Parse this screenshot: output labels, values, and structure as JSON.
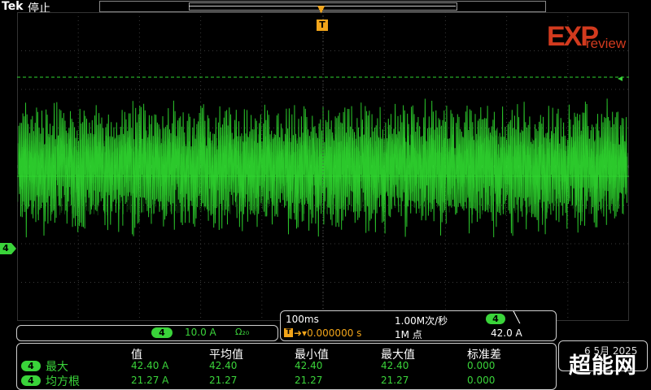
{
  "header": {
    "brand": "Tek",
    "status": "停止"
  },
  "logo": {
    "main": "EXP",
    "sub": "review"
  },
  "markers": {
    "trigger": "T",
    "channel": "4",
    "level": "◂"
  },
  "channel_panel": {
    "badge": "4",
    "scale": "10.0 A",
    "coupling": "Ω₂₀"
  },
  "acquisition": {
    "timebase": "100ms",
    "sample_rate": "1.00M次/秒",
    "trigger_source": "4",
    "trigger_slope": "╲",
    "trigger_icon": "T",
    "position": "➜▾0.000000 s",
    "record_length": "1M 点",
    "trigger_level": "42.0 A"
  },
  "measurements": {
    "headers": [
      "值",
      "平均值",
      "最小值",
      "最大值",
      "标准差"
    ],
    "rows": [
      {
        "badge": "4",
        "name": "最大",
        "values": [
          "42.40 A",
          "42.40",
          "42.40",
          "42.40",
          "0.000"
        ]
      },
      {
        "badge": "4",
        "name": "均方根",
        "values": [
          "21.27 A",
          "21.27",
          "21.27",
          "21.27",
          "0.000"
        ]
      }
    ]
  },
  "date": "6 5月 2025",
  "watermark": "超能网",
  "colors": {
    "trace": "#2fd62f",
    "trigger": "#f2a51a",
    "logo": "#d23a1e",
    "grid": "#333333"
  }
}
